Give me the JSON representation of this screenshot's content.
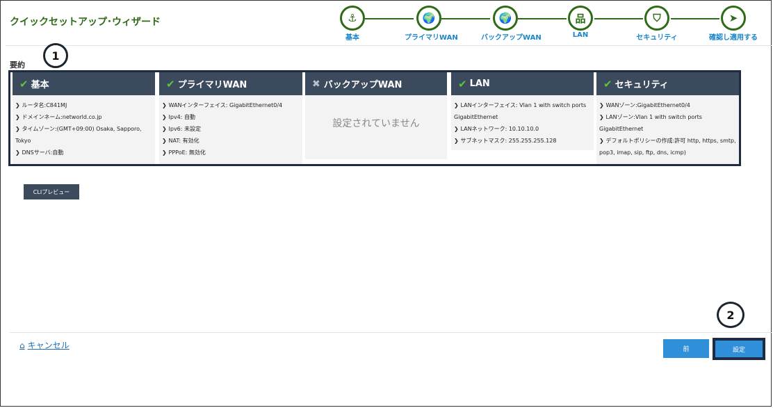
{
  "header": {
    "title": "クイックセットアップ･ウィザード"
  },
  "steps": [
    {
      "label": "基本",
      "icon": "anchor-icon",
      "glyph": "⚓"
    },
    {
      "label": "プライマリWAN",
      "icon": "globe-icon",
      "glyph": "🌍"
    },
    {
      "label": "バックアップWAN",
      "icon": "globe-icon",
      "glyph": "🌍"
    },
    {
      "label": "LAN",
      "icon": "network-icon",
      "glyph": "品"
    },
    {
      "label": "セキュリティ",
      "icon": "shield-icon",
      "glyph": "⛉"
    },
    {
      "label": "確認し適用する",
      "icon": "send-icon",
      "glyph": "➤"
    }
  ],
  "summary": {
    "label": "要約",
    "columns": [
      {
        "title": "基本",
        "status": "check",
        "rows": [
          "ルータ名:C841MJ",
          "ドメインネーム:networld.co.jp",
          "タイムゾーン:(GMT+09:00) Osaka, Sapporo, Tokyo",
          "DNSサーバ:自動"
        ]
      },
      {
        "title": "プライマリWAN",
        "status": "check",
        "rows": [
          "WANインターフェイス: GigabitEthernet0/4",
          "Ipv4: 自動",
          "Ipv6: 未設定",
          "NAT: 有効化",
          "PPPoE: 無効化"
        ]
      },
      {
        "title": "バックアップWAN",
        "status": "cross",
        "empty": "設定されていません"
      },
      {
        "title": "LAN",
        "status": "check",
        "rows": [
          "LANインターフェイス: Vlan 1 with switch ports GigabitEthernet",
          "LANネットワーク: 10.10.10.0",
          "サブネットマスク: 255.255.255.128"
        ]
      },
      {
        "title": "セキュリティ",
        "status": "check",
        "rows": [
          "WANゾーン:GigabitEthernet0/4",
          "LANゾーン:Vlan 1 with switch ports GigabitEthernet",
          "デフォルトポリシーの作成:許可 http, https, smtp, pop3, imap, sip, ftp, dns, icmp)"
        ]
      }
    ]
  },
  "callouts": {
    "one": "1",
    "two": "2"
  },
  "buttons": {
    "cli": "CLIプレビュー",
    "prev": "前",
    "next": "設定"
  },
  "footer": {
    "cancel": "キャンセル"
  },
  "colors": {
    "accent": "#2e6b16",
    "header_bar": "#3c4a5e",
    "button": "#2f8fd8",
    "check": "#5ac63b"
  }
}
